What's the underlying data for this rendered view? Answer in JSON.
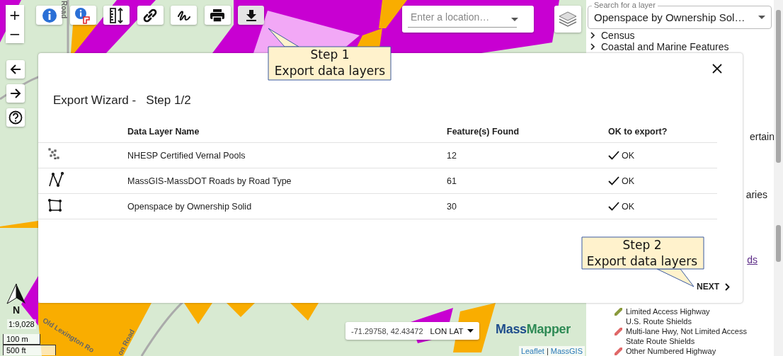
{
  "map": {
    "zoom_buttons": [
      "+",
      "−"
    ],
    "tools": [
      {
        "kind": "identify",
        "selected": false
      },
      {
        "kind": "identify-area",
        "selected": false
      },
      {
        "kind": "measure",
        "selected": false
      },
      {
        "kind": "link",
        "selected": false
      },
      {
        "kind": "draw",
        "selected": false
      },
      {
        "kind": "print",
        "selected": false
      },
      {
        "kind": "export",
        "selected": true
      }
    ],
    "location_search": {
      "placeholder": "Enter a location…"
    },
    "road_labels": [
      "Road",
      "Old Lexington Ro",
      "on Road"
    ],
    "north_label": "N",
    "scale_ratio": "1:9,028",
    "scale_bars": [
      "100 m",
      "500 ft"
    ],
    "coordinates": "-71.29758, 42.43472",
    "coordinate_format": "LON LAT",
    "logo": [
      "Mass",
      "Mapper"
    ],
    "attribution": [
      "Leaflet",
      "|",
      "MassGIS"
    ]
  },
  "layer_panel": {
    "search": {
      "label": "Search for a layer",
      "value": "Openspace by Ownership Sol…"
    },
    "categories": [
      "Census",
      "Coastal and Marine Features"
    ],
    "fragments": [
      "ertain",
      "aries"
    ],
    "link": "ds",
    "legend": [
      {
        "kind": "symbol",
        "label": "Limited Access Highway",
        "color": "#8a9a3c"
      },
      {
        "kind": "text",
        "label": "U.S. Route Shields"
      },
      {
        "kind": "symbol",
        "label": "Multi-lane Hwy, Not Limited Access",
        "color": "#e06868"
      },
      {
        "kind": "text",
        "label": "State Route Shields"
      },
      {
        "kind": "symbol",
        "label": "Other Numbered Highway",
        "color": "#e06868"
      }
    ]
  },
  "dialog": {
    "title": "Export Wizard -   Step 1/2",
    "columns": [
      "Data Layer Name",
      "Feature(s) Found",
      "OK to export?"
    ],
    "rows": [
      {
        "kind": "point",
        "name": "NHESP Certified Vernal Pools",
        "count": "12",
        "ok": true,
        "status": "OK"
      },
      {
        "kind": "line",
        "name": "MassGIS-MassDOT Roads by Road Type",
        "count": "61",
        "ok": true,
        "status": "OK"
      },
      {
        "kind": "polygon",
        "name": "Openspace by Ownership Solid",
        "count": "30",
        "ok": true,
        "status": "OK"
      }
    ],
    "next_button": "NEXT"
  },
  "callouts": [
    {
      "title": "Step 1",
      "text": "Export data layers"
    },
    {
      "title": "Step 2",
      "text": "Export data layers"
    }
  ]
}
